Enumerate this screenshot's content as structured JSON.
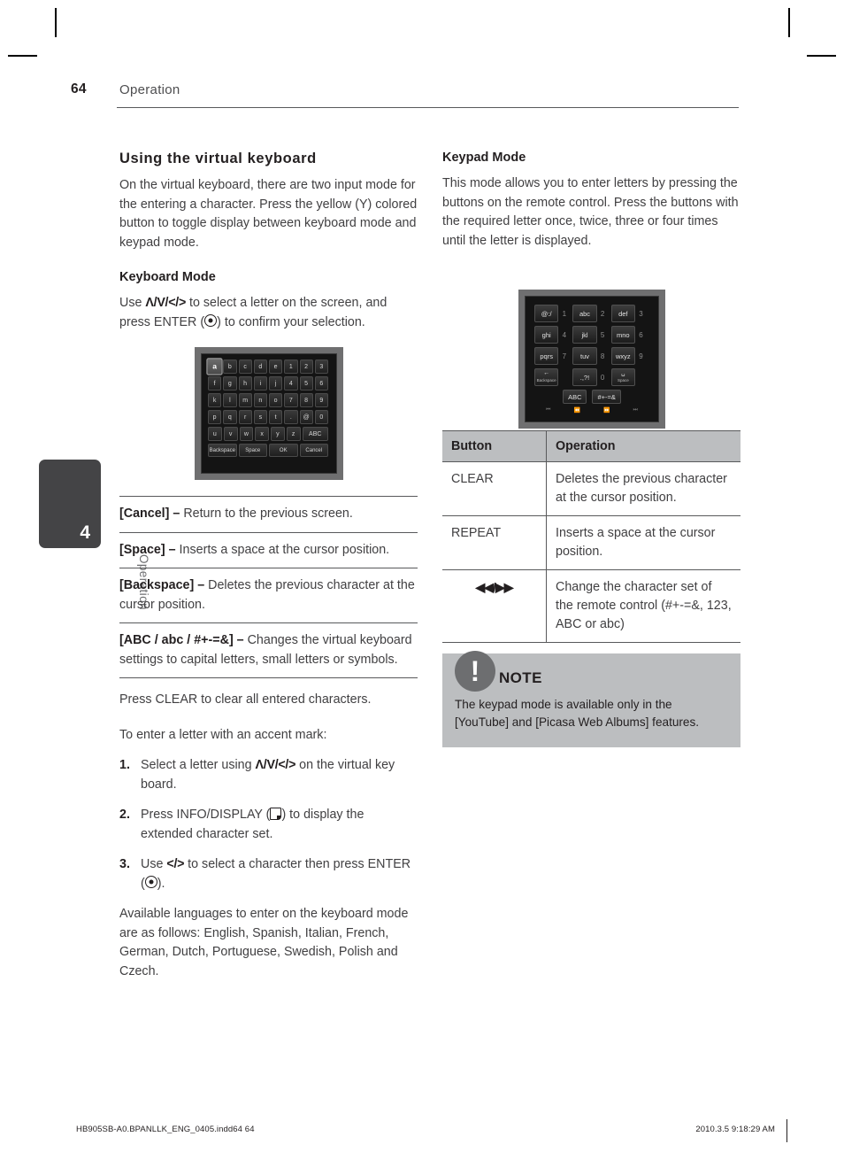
{
  "header": {
    "page_number": "64",
    "section": "Operation"
  },
  "chapter_tab": {
    "number": "4",
    "label": "Operation"
  },
  "left_column": {
    "title": "Using the virtual keyboard",
    "intro": "On the virtual keyboard, there are two input mode for the entering a character. Press the yellow (Y) colored button to toggle display between keyboard mode and keypad mode.",
    "keyboard_mode_heading": "Keyboard Mode",
    "keyboard_mode_text_1": "Use ",
    "keyboard_mode_symbols": "Λ/V/</>",
    "keyboard_mode_text_2": " to select a letter on the screen, and press ENTER (",
    "keyboard_mode_text_3": ") to confirm your selection.",
    "definitions": [
      {
        "term": "[Cancel] – ",
        "desc": "Return to the previous screen."
      },
      {
        "term": "[Space] – ",
        "desc": "Inserts a space at the cursor position."
      },
      {
        "term": "[Backspace] – ",
        "desc": "Deletes the previous character at the cursor position."
      },
      {
        "term": "[ABC / abc / #+-=&] – ",
        "desc": "Changes the virtual keyboard settings to capital letters, small letters or symbols."
      }
    ],
    "clear_note": "Press CLEAR to clear all entered characters.",
    "accent_intro": "To enter a letter with an accent mark:",
    "steps": [
      {
        "num": "1.",
        "pre": "Select a letter using ",
        "symbols": "Λ/V/</>",
        "post": " on the virtual key board."
      },
      {
        "num": "2.",
        "pre": "Press INFO/DISPLAY (",
        "post": ") to display the extended character set."
      },
      {
        "num": "3.",
        "pre": "Use ",
        "symbols": "</>",
        "post": " to select a character then press ENTER (",
        "tail": ")."
      }
    ],
    "languages": "Available languages to enter on the keyboard mode are as follows: English, Spanish, Italian, French, German, Dutch, Portuguese, Swedish, Polish and Czech."
  },
  "virtual_keyboard": {
    "rows": [
      [
        "a",
        "b",
        "c",
        "d",
        "e",
        "1",
        "2",
        "3"
      ],
      [
        "f",
        "g",
        "h",
        "i",
        "j",
        "4",
        "5",
        "6"
      ],
      [
        "k",
        "l",
        "m",
        "n",
        "o",
        "7",
        "8",
        "9"
      ],
      [
        "p",
        "q",
        "r",
        "s",
        "t",
        ".",
        "@",
        "0"
      ],
      [
        "u",
        "v",
        "w",
        "x",
        "y",
        "z",
        "ABC"
      ],
      [
        "Backspace",
        "Space",
        "OK",
        "Cancel"
      ]
    ],
    "selected_key": "a"
  },
  "keypad": {
    "rows": [
      [
        {
          "label": "@:/",
          "num": "1"
        },
        {
          "label": "abc",
          "num": "2"
        },
        {
          "label": "def",
          "num": "3"
        }
      ],
      [
        {
          "label": "ghi",
          "num": "4"
        },
        {
          "label": "jkl",
          "num": "5"
        },
        {
          "label": "mno",
          "num": "6"
        }
      ],
      [
        {
          "label": "pqrs",
          "num": "7"
        },
        {
          "label": "tuv",
          "num": "8"
        },
        {
          "label": "wxyz",
          "num": "9"
        }
      ],
      [
        {
          "label": "←",
          "sublabel": "Backspace",
          "num": ""
        },
        {
          "label": ".,?!",
          "num": "0"
        },
        {
          "label": "␣",
          "sublabel": "Space",
          "num": ""
        }
      ]
    ],
    "bottom_buttons": [
      "ABC",
      "#+-=&"
    ],
    "transport_icons": [
      "⏮",
      "⏪",
      "⏩",
      "⏭"
    ]
  },
  "right_column": {
    "title": "Keypad Mode",
    "intro": "This mode allows you to enter letters by pressing the buttons on the remote control. Press the buttons with the required letter once, twice, three or four times until the letter is displayed."
  },
  "table": {
    "headers": [
      "Button",
      "Operation"
    ],
    "rows": [
      {
        "button": "CLEAR",
        "operation": "Deletes the previous character at the cursor position."
      },
      {
        "button": "REPEAT",
        "operation": "Inserts a space at the cursor position."
      },
      {
        "button": "◀◀/▶▶",
        "operation": "Change the character set of the remote control (#+-=&, 123, ABC or abc)"
      }
    ]
  },
  "note": {
    "badge": "!",
    "title": "NOTE",
    "text": "The keypad mode is available only in the [YouTube] and [Picasa Web Albums] features."
  },
  "footer": {
    "left": "HB905SB-A0.BPANLLK_ENG_0405.indd64   64",
    "right": "2010.3.5   9:18:29 AM"
  }
}
